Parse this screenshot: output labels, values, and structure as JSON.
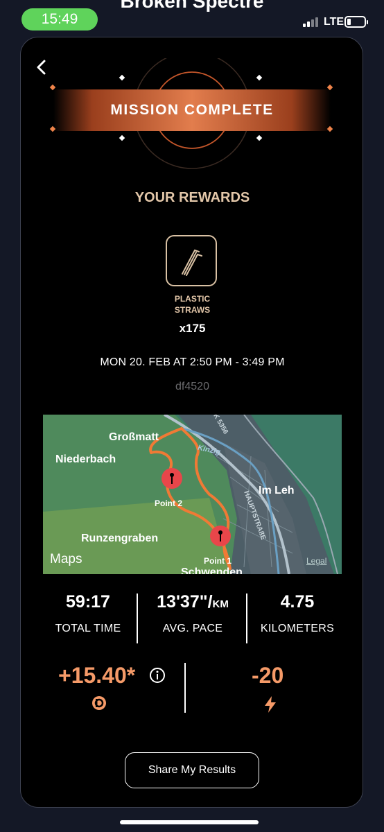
{
  "status_bar": {
    "time": "15:49",
    "network": "LTE",
    "background_title": "Broken Spectre"
  },
  "mission": {
    "banner": "MISSION COMPLETE",
    "rewards_title": "YOUR REWARDS",
    "reward": {
      "name_line1": "PLASTIC",
      "name_line2": "STRAWS",
      "quantity": "x175",
      "icon": "plastic-straws-icon"
    },
    "date_range": "MON 20. FEB AT 2:50 PM - 3:49 PM",
    "id": "df4520"
  },
  "map": {
    "places": [
      "Großmatt",
      "Niederbach",
      "Runzengraben",
      "Im Leh",
      "Schwenden"
    ],
    "road_labels": [
      "K 5356",
      "Kinzig",
      "HAUPTSTRAßE"
    ],
    "pins": [
      "Point 2",
      "Point 1"
    ],
    "attribution": "Maps",
    "legal": "Legal"
  },
  "stats": [
    {
      "value": "59:17",
      "label": "TOTAL TIME"
    },
    {
      "value": "13'37\"/",
      "unit": "KM",
      "label": "AVG. PACE"
    },
    {
      "value": "4.75",
      "label": "KILOMETERS"
    }
  ],
  "earnings": {
    "coins": "+15.40*",
    "coin_icon": "coin-icon",
    "energy": "-20",
    "energy_icon": "lightning-icon"
  },
  "actions": {
    "share": "Share My Results"
  },
  "colors": {
    "accent": "#f59a68",
    "gold_text": "#e3c7a9",
    "map_water": "#3c7a66",
    "route": "#f07a35",
    "pin": "#e8464a"
  }
}
